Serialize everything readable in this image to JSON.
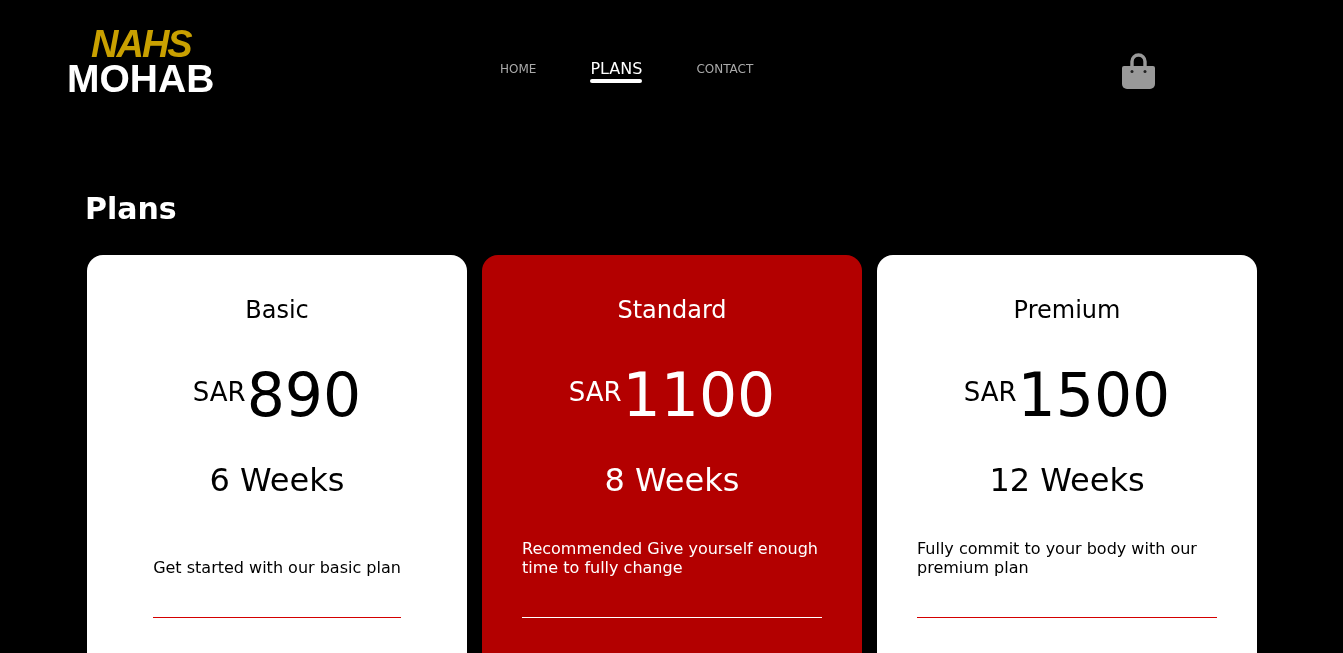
{
  "header": {
    "logo": {
      "accent": "NAHS",
      "main": "MOHAB"
    },
    "nav": [
      {
        "label": "HOME",
        "selected": false
      },
      {
        "label": "PLANS",
        "selected": true
      },
      {
        "label": "CONTACT",
        "selected": false
      }
    ]
  },
  "section": {
    "title": "Plans"
  },
  "plans": [
    {
      "name": "Basic",
      "currency": "SAR",
      "price": "890",
      "duration": "6 Weeks",
      "description": "Get started with our basic plan",
      "featured": false
    },
    {
      "name": "Standard",
      "currency": "SAR",
      "price": "1100",
      "duration": "8 Weeks",
      "description": "Recommended Give yourself enough time to fully change",
      "featured": true
    },
    {
      "name": "Premium",
      "currency": "SAR",
      "price": "1500",
      "duration": "12 Weeks",
      "description": "Fully commit to your body with our premium plan",
      "featured": false
    }
  ]
}
